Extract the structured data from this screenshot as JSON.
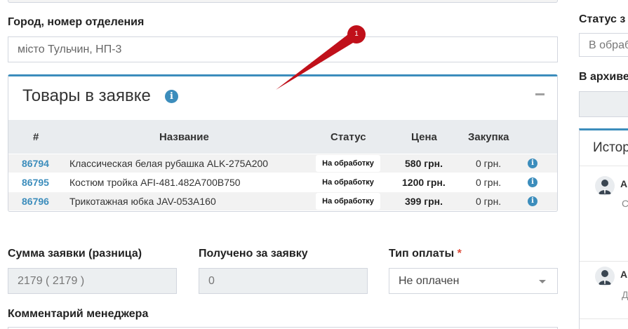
{
  "form": {
    "city_label": "Город, номер отделения",
    "city_value": "місто Тульчин, НП-3",
    "sum_label": "Сумма заявки (разница)",
    "sum_value": "2179   ( 2179 )",
    "received_label": "Получено за заявку",
    "received_value": "0",
    "payment_label": "Тип оплаты",
    "payment_required": "*",
    "payment_value": "Не оплачен",
    "comment_label": "Комментарий менеджера"
  },
  "products": {
    "title": "Товары в заявке",
    "columns": [
      "#",
      "Название",
      "Статус",
      "Цена",
      "Закупка"
    ],
    "rows": [
      {
        "id": "86794",
        "name": "Классическая белая рубашка ALK-275A200",
        "status": "На обработку",
        "price": "580 грн.",
        "purchase": "0 грн."
      },
      {
        "id": "86795",
        "name": "Костюм тройка AFI-481.482A700B750",
        "status": "На обработку",
        "price": "1200 грн.",
        "purchase": "0 грн."
      },
      {
        "id": "86796",
        "name": "Трикотажная юбка JAV-053A160",
        "status": "На обработку",
        "price": "399 грн.",
        "purchase": "0 грн."
      }
    ]
  },
  "sidebar": {
    "status_label": "Статус з",
    "status_value": "В обраб",
    "archive_label": "В архиве",
    "history_title": "Истор",
    "history": [
      {
        "name": "А",
        "text": "С"
      },
      {
        "name": "А",
        "text": "Д"
      }
    ]
  },
  "annotation": {
    "number": "1",
    "color": "#c0101a"
  },
  "colors": {
    "accent": "#3c8dbc",
    "required": "#dd4b39"
  }
}
